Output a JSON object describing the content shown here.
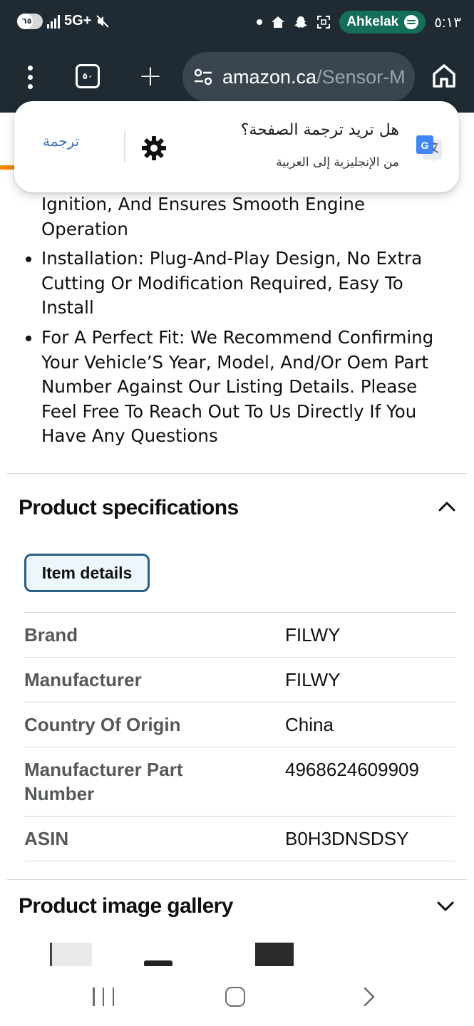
{
  "status_bar": {
    "battery": "٦٥",
    "network": "5G+",
    "pill_label": "Ahkelak",
    "time": "٥:١٣"
  },
  "toolbar": {
    "tab_count": "٥٠",
    "url_domain": "amazon.ca",
    "url_path": "/Sensor-M"
  },
  "translate_prompt": {
    "title": "هل تريد ترجمة الصفحة؟",
    "subtitle": "من الإنجليزية إلى العربية",
    "translate_button": "ترجمة"
  },
  "features": [
    "Ignition, And Ensures Smooth Engine Operation",
    "Installation: Plug-And-Play Design, No Extra Cutting Or Modification Required, Easy To Install",
    "For A Perfect Fit: We Recommend Confirming Your Vehicle’S Year, Model, And/Or Oem Part Number Against Our Listing Details. Please Feel Free To Reach Out To Us Directly If You Have Any Questions"
  ],
  "specs": {
    "heading": "Product specifications",
    "tab_label": "Item details",
    "rows": [
      {
        "key": "Brand",
        "value": "FILWY"
      },
      {
        "key": "Manufacturer",
        "value": "FILWY"
      },
      {
        "key": "Country Of Origin",
        "value": "China"
      },
      {
        "key": "Manufacturer Part Number",
        "value": "4968624609909"
      },
      {
        "key": "ASIN",
        "value": "B0H3DNSDSY"
      }
    ]
  },
  "gallery": {
    "heading": "Product image gallery"
  },
  "icons": {
    "menu": "kebab-menu-icon",
    "tabs": "tab-switcher-icon",
    "new_tab": "plus-icon",
    "site_settings": "tune-icon",
    "home": "home-icon",
    "settings": "gear-icon",
    "translate": "google-translate-icon",
    "collapse": "chevron-up-icon",
    "expand": "chevron-down-icon"
  },
  "colors": {
    "chrome_bg": "#1f2a33",
    "spotify_pill": "#156e5a",
    "link_blue": "#3f6fc4",
    "tab_border": "#2b5f8a",
    "amazon_orange": "#f08804"
  }
}
